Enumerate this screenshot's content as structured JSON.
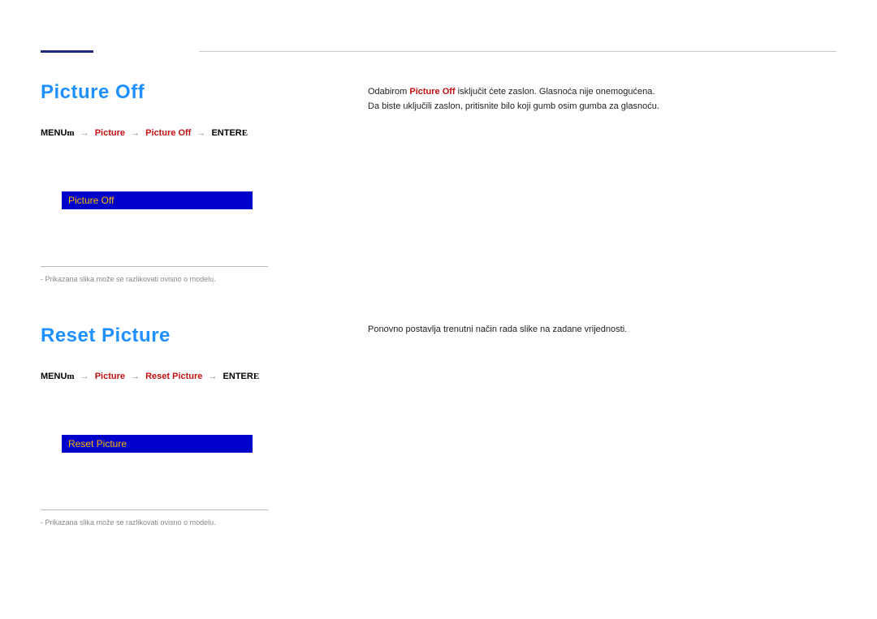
{
  "section1": {
    "title": "Picture Off",
    "breadcrumb": {
      "menu": "MENU",
      "menuIcon": "m",
      "item1": "Picture",
      "item2": "Picture Off",
      "enter": "ENTER",
      "enterIcon": "E"
    },
    "bar_label": "Picture Off",
    "footnote": "-  Prikazana slika može se razlikovati ovisno o modelu."
  },
  "right1": {
    "line1a": "Odabirom ",
    "line1red": "Picture Off",
    "line1b": "isključit ćete zaslon. Glasnoća nije onemogućena.",
    "line2": "Da biste uključili zaslon, pritisnite bilo koji gumb osim gumba za glasnoću."
  },
  "section2": {
    "title": "Reset Picture",
    "breadcrumb": {
      "menu": "MENU",
      "menuIcon": "m",
      "item1": "Picture",
      "item2": "Reset Picture",
      "enter": "ENTER",
      "enterIcon": "E"
    },
    "bar_label": "Reset Picture",
    "footnote": "-  Prikazana slika može se razlikovati ovisno o modelu."
  },
  "right2": {
    "line1": "Ponovno postavlja trenutni način rada slike na zadane vrijednosti."
  }
}
